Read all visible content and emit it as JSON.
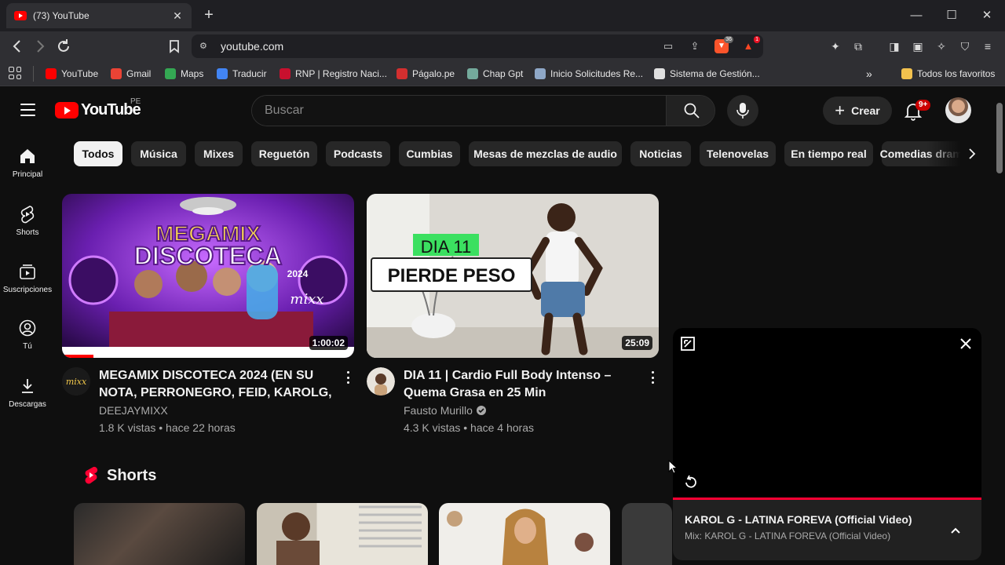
{
  "browser": {
    "tab_title": "(73) YouTube",
    "url": "youtube.com",
    "shield_count": "36",
    "reward_count": "1",
    "bookmarks": [
      {
        "label": "YouTube",
        "icon": "youtube-icon",
        "color": "#ff0000"
      },
      {
        "label": "Gmail",
        "icon": "gmail-icon",
        "color": "#ea4335"
      },
      {
        "label": "Maps",
        "icon": "maps-icon",
        "color": "#34a853"
      },
      {
        "label": "Traducir",
        "icon": "translate-icon",
        "color": "#4285f4"
      },
      {
        "label": "RNP | Registro Naci...",
        "icon": "rnp-icon",
        "color": "#c8102e"
      },
      {
        "label": "Págalo.pe",
        "icon": "pagalo-icon",
        "color": "#d32f2f"
      },
      {
        "label": "Chap Gpt",
        "icon": "chatgpt-icon",
        "color": "#74aa9c"
      },
      {
        "label": "Inicio Solicitudes Re...",
        "icon": "solicitudes-icon",
        "color": "#8fa8c8"
      },
      {
        "label": "Sistema de Gestión...",
        "icon": "sistema-icon",
        "color": "#e0e0e0"
      }
    ],
    "all_bookmarks": "Todos los favoritos"
  },
  "youtube": {
    "country": "PE",
    "search_placeholder": "Buscar",
    "create_label": "Crear",
    "notifications": "9+",
    "sidebar": [
      {
        "label": "Principal",
        "icon": "home-icon"
      },
      {
        "label": "Shorts",
        "icon": "shorts-icon"
      },
      {
        "label": "Suscripciones",
        "icon": "subscriptions-icon"
      },
      {
        "label": "Tú",
        "icon": "you-icon"
      },
      {
        "label": "Descargas",
        "icon": "download-icon"
      }
    ],
    "chips": [
      "Todos",
      "Música",
      "Mixes",
      "Reguetón",
      "Podcasts",
      "Cumbias",
      "Mesas de mezclas de audio",
      "Noticias",
      "Telenovelas",
      "En tiempo real",
      "Comedias dramáticas"
    ],
    "videos": [
      {
        "title": "MEGAMIX DISCOTECA 2024 (EN SU NOTA, PERRONEGRO, FEID, KAROLG, ...",
        "channel": "DEEJAYMIXX",
        "meta": "1.8 K vistas • hace 22 horas",
        "duration": "1:00:02",
        "thumb_text_1": "MEGAMIX",
        "thumb_text_2": "DISCOTECA",
        "thumb_year": "2024",
        "thumb_logo": "mixx"
      },
      {
        "title": "DIA 11 | Cardio Full Body Intenso – Quema Grasa en 25 Min",
        "channel": "Fausto Murillo",
        "meta": "4.3 K vistas • hace 4 horas",
        "duration": "25:09",
        "thumb_text_1": "DIA 11",
        "thumb_text_2": "PIERDE PESO"
      }
    ],
    "shorts_title": "Shorts",
    "miniplayer": {
      "title": "KAROL G - LATINA FOREVA (Official Video)",
      "subtitle": "Mix: KAROL G - LATINA FOREVA (Official Video)"
    }
  },
  "colors": {
    "accent": "#ff0000",
    "background": "#0f0f0f"
  }
}
